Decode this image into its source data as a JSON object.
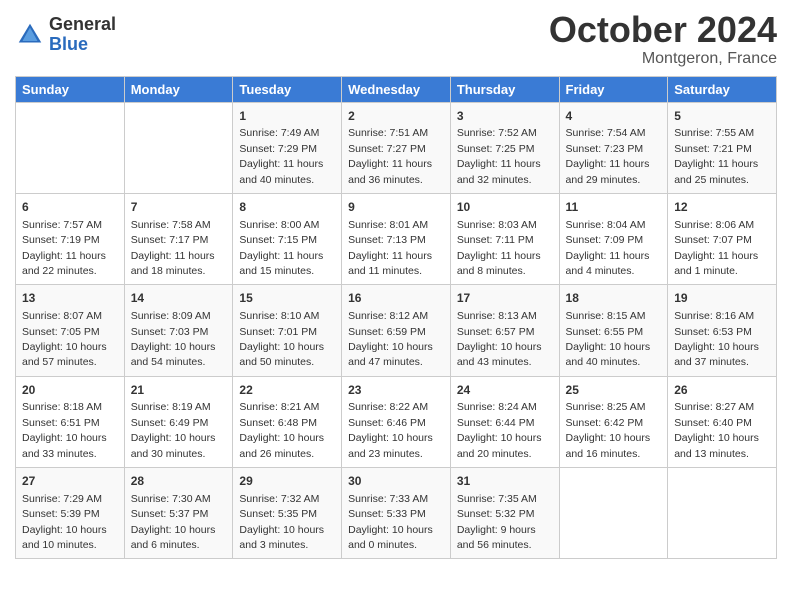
{
  "header": {
    "logo_general": "General",
    "logo_blue": "Blue",
    "month_title": "October 2024",
    "location": "Montgeron, France"
  },
  "days_of_week": [
    "Sunday",
    "Monday",
    "Tuesday",
    "Wednesday",
    "Thursday",
    "Friday",
    "Saturday"
  ],
  "weeks": [
    [
      {
        "day": "",
        "info": ""
      },
      {
        "day": "",
        "info": ""
      },
      {
        "day": "1",
        "info": "Sunrise: 7:49 AM\nSunset: 7:29 PM\nDaylight: 11 hours and 40 minutes."
      },
      {
        "day": "2",
        "info": "Sunrise: 7:51 AM\nSunset: 7:27 PM\nDaylight: 11 hours and 36 minutes."
      },
      {
        "day": "3",
        "info": "Sunrise: 7:52 AM\nSunset: 7:25 PM\nDaylight: 11 hours and 32 minutes."
      },
      {
        "day": "4",
        "info": "Sunrise: 7:54 AM\nSunset: 7:23 PM\nDaylight: 11 hours and 29 minutes."
      },
      {
        "day": "5",
        "info": "Sunrise: 7:55 AM\nSunset: 7:21 PM\nDaylight: 11 hours and 25 minutes."
      }
    ],
    [
      {
        "day": "6",
        "info": "Sunrise: 7:57 AM\nSunset: 7:19 PM\nDaylight: 11 hours and 22 minutes."
      },
      {
        "day": "7",
        "info": "Sunrise: 7:58 AM\nSunset: 7:17 PM\nDaylight: 11 hours and 18 minutes."
      },
      {
        "day": "8",
        "info": "Sunrise: 8:00 AM\nSunset: 7:15 PM\nDaylight: 11 hours and 15 minutes."
      },
      {
        "day": "9",
        "info": "Sunrise: 8:01 AM\nSunset: 7:13 PM\nDaylight: 11 hours and 11 minutes."
      },
      {
        "day": "10",
        "info": "Sunrise: 8:03 AM\nSunset: 7:11 PM\nDaylight: 11 hours and 8 minutes."
      },
      {
        "day": "11",
        "info": "Sunrise: 8:04 AM\nSunset: 7:09 PM\nDaylight: 11 hours and 4 minutes."
      },
      {
        "day": "12",
        "info": "Sunrise: 8:06 AM\nSunset: 7:07 PM\nDaylight: 11 hours and 1 minute."
      }
    ],
    [
      {
        "day": "13",
        "info": "Sunrise: 8:07 AM\nSunset: 7:05 PM\nDaylight: 10 hours and 57 minutes."
      },
      {
        "day": "14",
        "info": "Sunrise: 8:09 AM\nSunset: 7:03 PM\nDaylight: 10 hours and 54 minutes."
      },
      {
        "day": "15",
        "info": "Sunrise: 8:10 AM\nSunset: 7:01 PM\nDaylight: 10 hours and 50 minutes."
      },
      {
        "day": "16",
        "info": "Sunrise: 8:12 AM\nSunset: 6:59 PM\nDaylight: 10 hours and 47 minutes."
      },
      {
        "day": "17",
        "info": "Sunrise: 8:13 AM\nSunset: 6:57 PM\nDaylight: 10 hours and 43 minutes."
      },
      {
        "day": "18",
        "info": "Sunrise: 8:15 AM\nSunset: 6:55 PM\nDaylight: 10 hours and 40 minutes."
      },
      {
        "day": "19",
        "info": "Sunrise: 8:16 AM\nSunset: 6:53 PM\nDaylight: 10 hours and 37 minutes."
      }
    ],
    [
      {
        "day": "20",
        "info": "Sunrise: 8:18 AM\nSunset: 6:51 PM\nDaylight: 10 hours and 33 minutes."
      },
      {
        "day": "21",
        "info": "Sunrise: 8:19 AM\nSunset: 6:49 PM\nDaylight: 10 hours and 30 minutes."
      },
      {
        "day": "22",
        "info": "Sunrise: 8:21 AM\nSunset: 6:48 PM\nDaylight: 10 hours and 26 minutes."
      },
      {
        "day": "23",
        "info": "Sunrise: 8:22 AM\nSunset: 6:46 PM\nDaylight: 10 hours and 23 minutes."
      },
      {
        "day": "24",
        "info": "Sunrise: 8:24 AM\nSunset: 6:44 PM\nDaylight: 10 hours and 20 minutes."
      },
      {
        "day": "25",
        "info": "Sunrise: 8:25 AM\nSunset: 6:42 PM\nDaylight: 10 hours and 16 minutes."
      },
      {
        "day": "26",
        "info": "Sunrise: 8:27 AM\nSunset: 6:40 PM\nDaylight: 10 hours and 13 minutes."
      }
    ],
    [
      {
        "day": "27",
        "info": "Sunrise: 7:29 AM\nSunset: 5:39 PM\nDaylight: 10 hours and 10 minutes."
      },
      {
        "day": "28",
        "info": "Sunrise: 7:30 AM\nSunset: 5:37 PM\nDaylight: 10 hours and 6 minutes."
      },
      {
        "day": "29",
        "info": "Sunrise: 7:32 AM\nSunset: 5:35 PM\nDaylight: 10 hours and 3 minutes."
      },
      {
        "day": "30",
        "info": "Sunrise: 7:33 AM\nSunset: 5:33 PM\nDaylight: 10 hours and 0 minutes."
      },
      {
        "day": "31",
        "info": "Sunrise: 7:35 AM\nSunset: 5:32 PM\nDaylight: 9 hours and 56 minutes."
      },
      {
        "day": "",
        "info": ""
      },
      {
        "day": "",
        "info": ""
      }
    ]
  ]
}
